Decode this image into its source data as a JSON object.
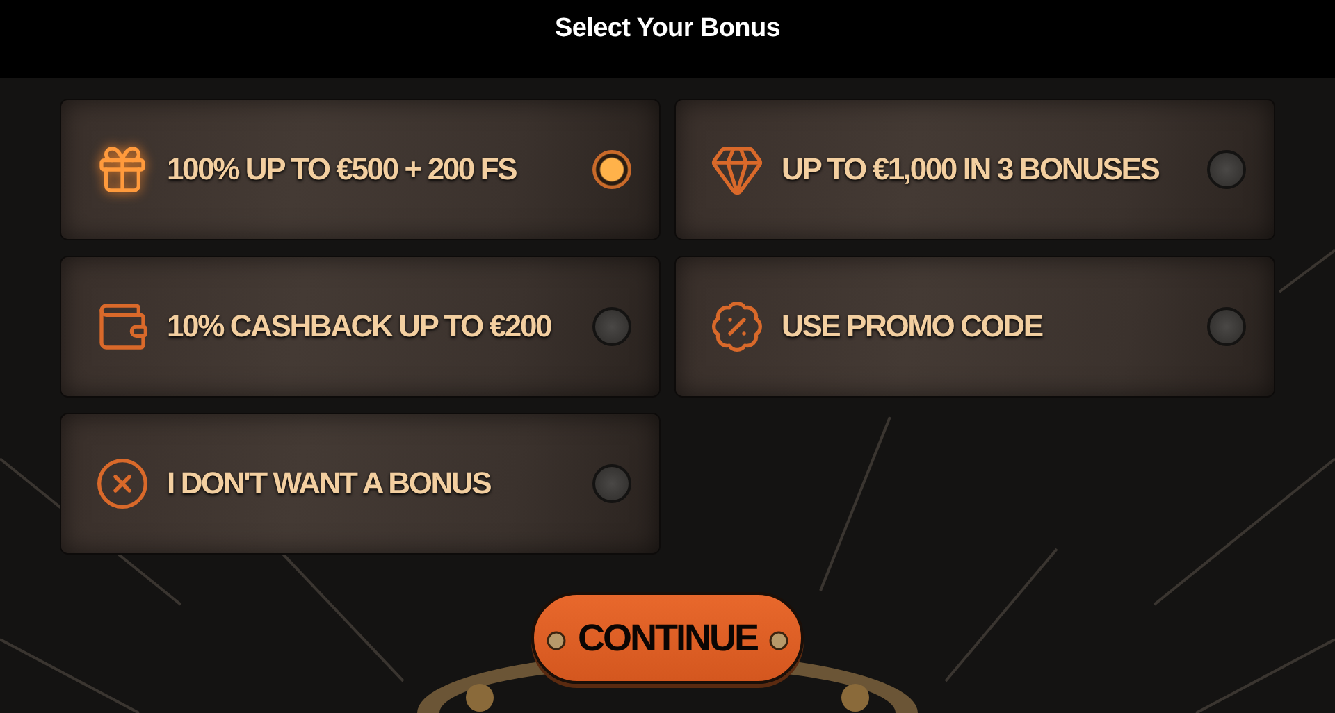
{
  "title": "Select Your Bonus",
  "options": [
    {
      "kind": "gift",
      "label": "100% UP TO €500 + 200 FS",
      "selected": true
    },
    {
      "kind": "diamond",
      "label": "UP TO €1,000 IN 3 BONUSES",
      "selected": false
    },
    {
      "kind": "wallet",
      "label": "10% CASHBACK UP TO €200",
      "selected": false
    },
    {
      "kind": "promo",
      "label": "USE PROMO CODE",
      "selected": false
    },
    {
      "kind": "none",
      "label": "I DON'T WANT A BONUS",
      "selected": false
    }
  ],
  "button": "CONTINUE"
}
